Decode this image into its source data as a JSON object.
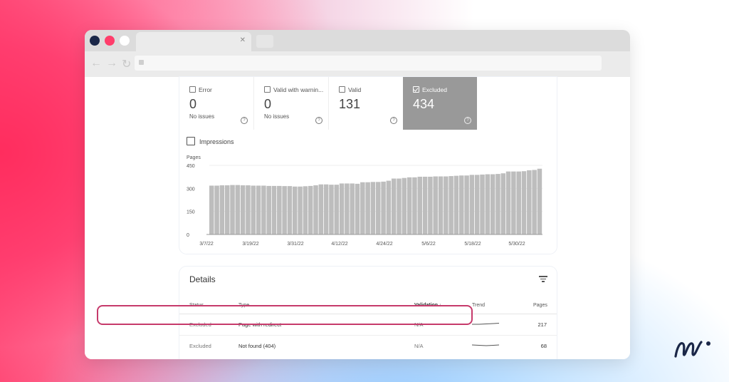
{
  "summary_cards": [
    {
      "label": "Error",
      "value": "0",
      "sub": "No issues",
      "selected": false
    },
    {
      "label": "Valid with warnin...",
      "value": "0",
      "sub": "No issues",
      "selected": false
    },
    {
      "label": "Valid",
      "value": "131",
      "sub": "",
      "selected": false
    },
    {
      "label": "Excluded",
      "value": "434",
      "sub": "",
      "selected": true
    }
  ],
  "impressions_label": "Impressions",
  "chart_data": {
    "type": "bar",
    "ylabel": "Pages",
    "ylim": [
      0,
      450
    ],
    "yticks": [
      "450",
      "300",
      "150",
      "0"
    ],
    "xticks": [
      "3/7/22",
      "3/19/22",
      "3/31/22",
      "4/12/22",
      "4/24/22",
      "5/6/22",
      "5/18/22",
      "5/30/22"
    ],
    "values": [
      318,
      318,
      320,
      320,
      322,
      322,
      320,
      320,
      318,
      318,
      318,
      316,
      316,
      316,
      315,
      315,
      312,
      312,
      314,
      316,
      320,
      326,
      326,
      324,
      324,
      332,
      332,
      332,
      330,
      340,
      340,
      342,
      342,
      344,
      350,
      364,
      364,
      368,
      372,
      372,
      376,
      376,
      376,
      378,
      378,
      378,
      380,
      382,
      384,
      384,
      388,
      388,
      390,
      392,
      392,
      394,
      398,
      410,
      410,
      410,
      412,
      418,
      420,
      428
    ]
  },
  "details": {
    "title": "Details",
    "headers": {
      "status": "Status",
      "type": "Type",
      "validation": "Validation",
      "trend": "Trend",
      "pages": "Pages"
    },
    "rows": [
      {
        "status": "Excluded",
        "type": "Page with redirect",
        "validation": "N/A",
        "pages": "217"
      },
      {
        "status": "Excluded",
        "type": "Not found (404)",
        "validation": "N/A",
        "pages": "68"
      }
    ]
  },
  "colors": {
    "accent_pink": "#ff3d6b",
    "highlight_border": "#c63a6b",
    "bar": "#bdbdbd",
    "brand_navy": "#1a2748"
  },
  "icons": [
    "close-icon",
    "back-arrow-icon",
    "forward-arrow-icon",
    "reload-icon",
    "lock-icon",
    "checkbox-icon",
    "help-icon",
    "filter-icon",
    "sort-down-icon",
    "brand-logo-icon"
  ]
}
